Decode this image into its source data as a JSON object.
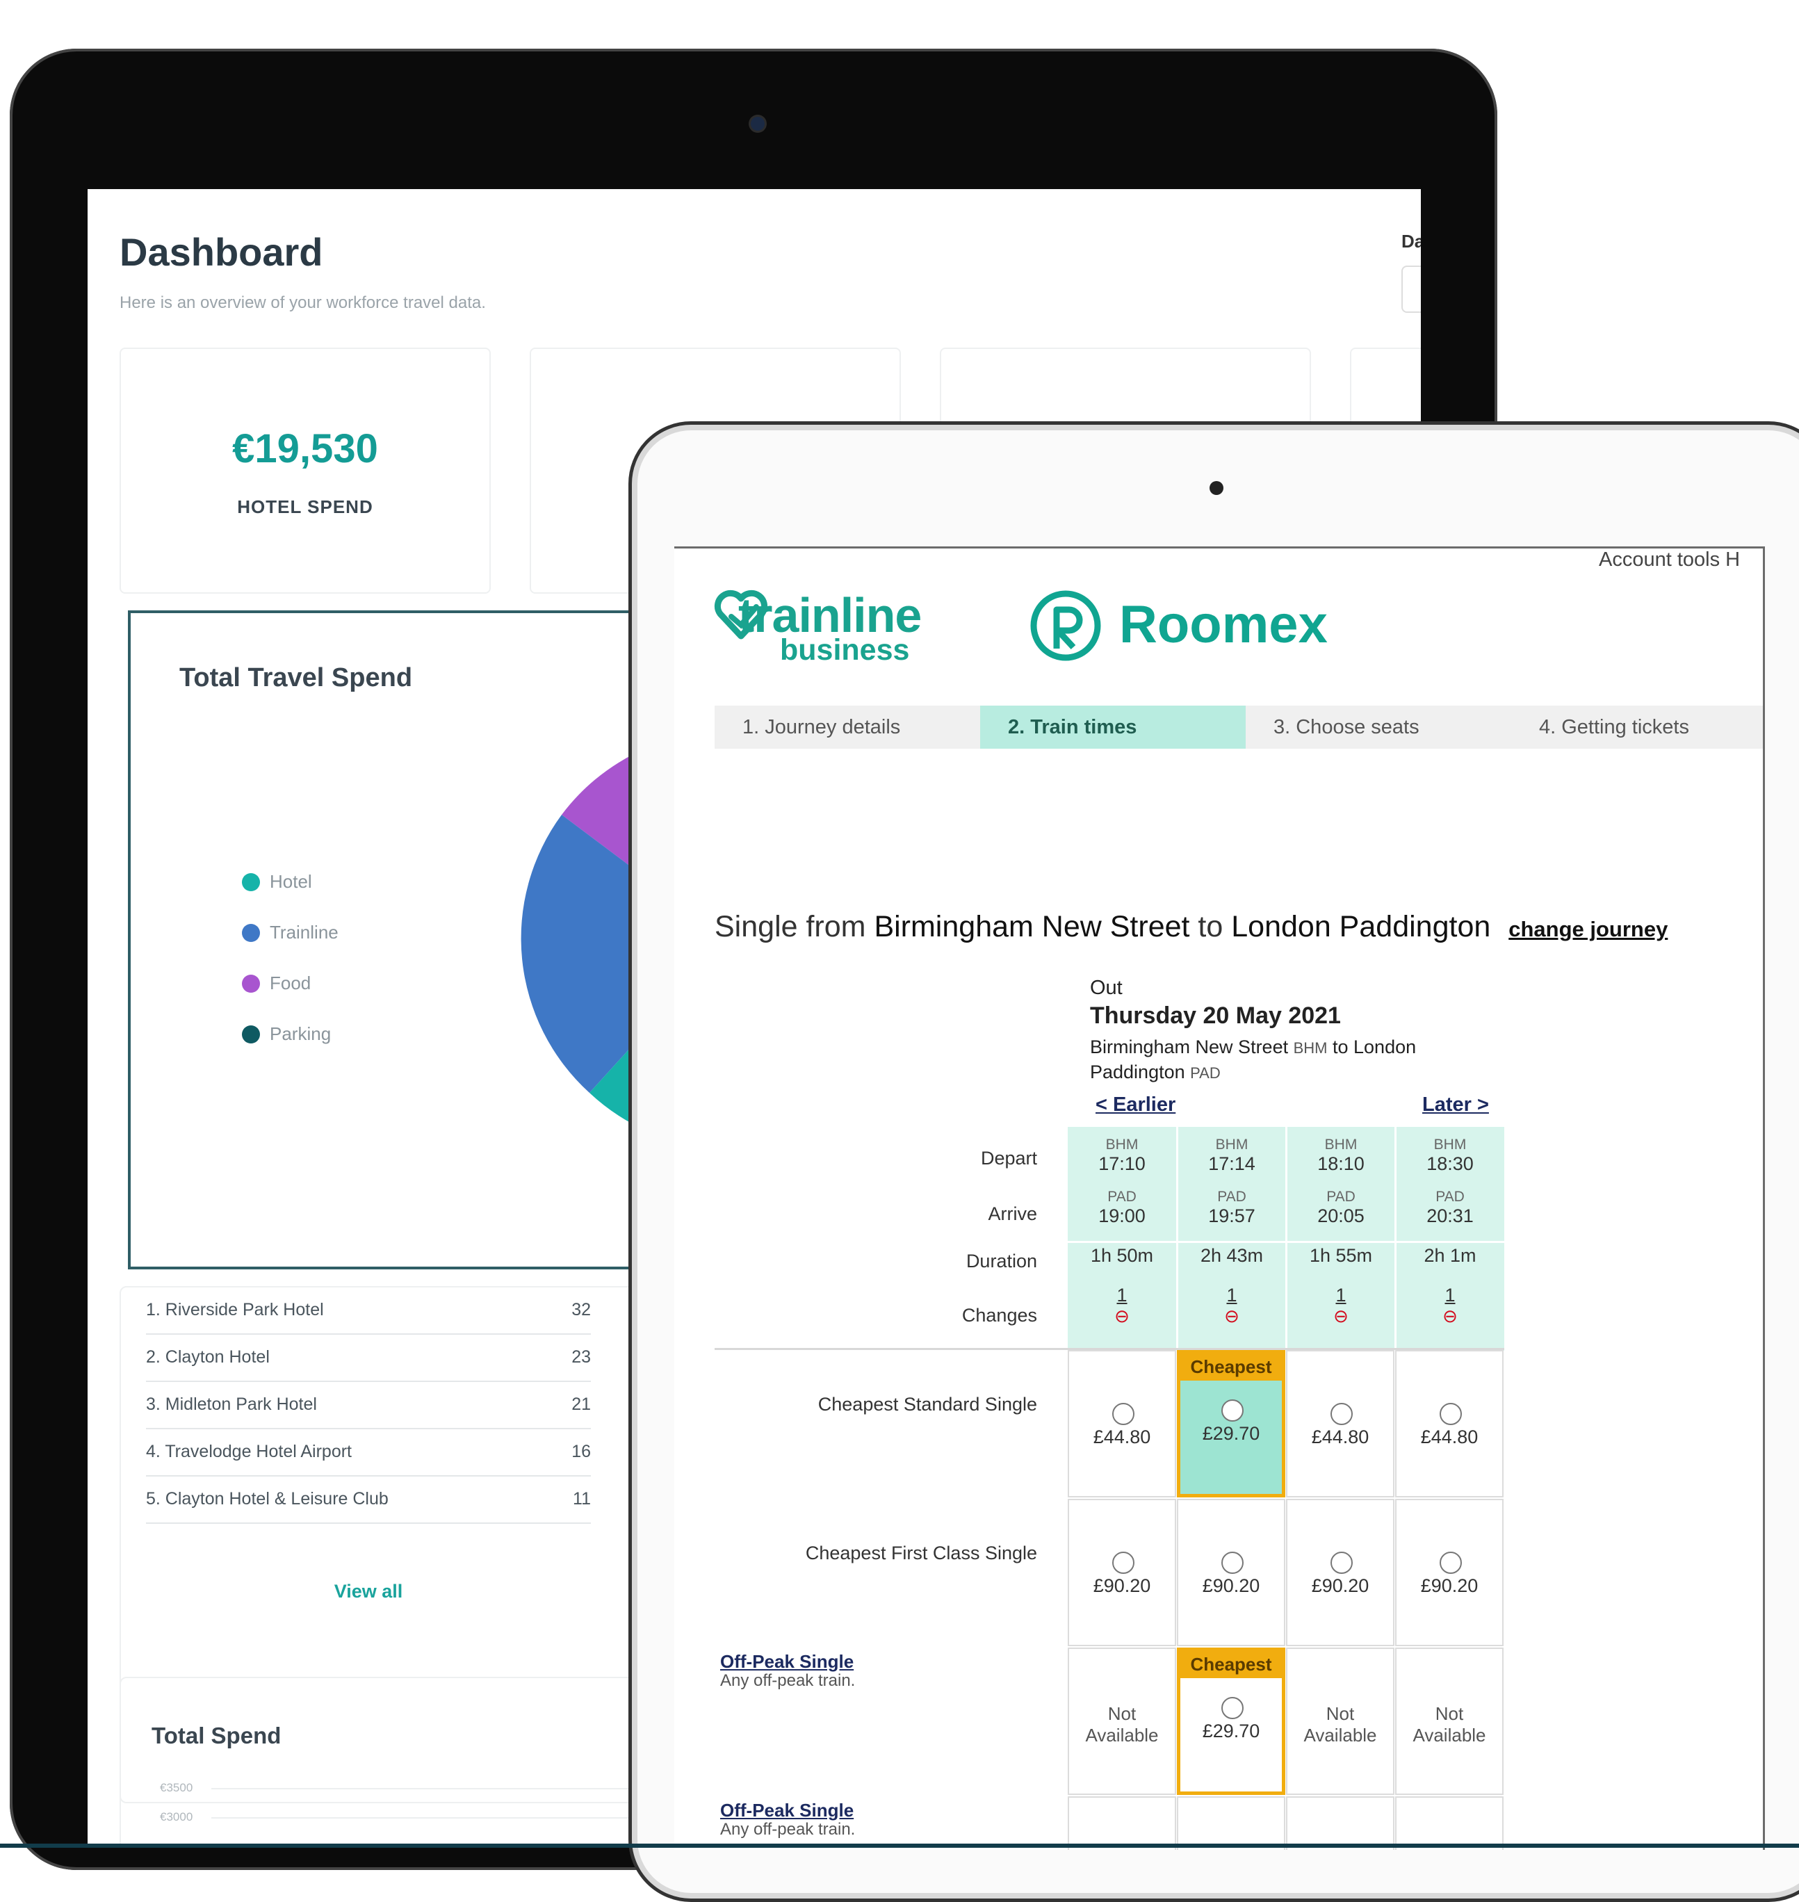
{
  "dashboard": {
    "title": "Dashboard",
    "subtitle": "Here is an overview of your workforce travel data.",
    "cut_off_label": "Da",
    "kpi": {
      "value": "€19,530",
      "label": "HOTEL SPEND"
    },
    "total_travel_spend": {
      "title": "Total Travel Spend",
      "legend": [
        {
          "label": "Hotel",
          "color": "#16b3a9"
        },
        {
          "label": "Trainline",
          "color": "#3f78c6"
        },
        {
          "label": "Food",
          "color": "#a855cf"
        },
        {
          "label": "Parking",
          "color": "#0f5a62"
        }
      ]
    },
    "top_hotels": [
      {
        "name": "1.  Riverside Park Hotel",
        "count": "32"
      },
      {
        "name": "2.  Clayton Hotel",
        "count": "23"
      },
      {
        "name": "3.  Midleton Park Hotel",
        "count": "21"
      },
      {
        "name": "4.  Travelodge Hotel Airport",
        "count": "16"
      },
      {
        "name": "5.  Clayton Hotel & Leisure Club",
        "count": "11"
      }
    ],
    "view_all": "View all",
    "total_spend": {
      "title": "Total Spend",
      "y_ticks": [
        "€3500",
        "€3000"
      ]
    }
  },
  "booking": {
    "account_tools": "Account tools   H",
    "brand": {
      "trainline": "trainline",
      "business": "business",
      "roomex": "Roomex"
    },
    "steps": [
      {
        "label": "1. Journey details"
      },
      {
        "label": "2. Train times",
        "active": true
      },
      {
        "label": "3. Choose seats"
      },
      {
        "label": "4. Getting tickets"
      }
    ],
    "journey": {
      "prefix": "Single from ",
      "from": "Birmingham New Street",
      "mid": " to ",
      "to": "London Paddington",
      "change_link": "change journey"
    },
    "out": {
      "label": "Out",
      "date": "Thursday 20 May 2021",
      "route_line1_a": "Birmingham New Street ",
      "route_line1_code": "BHM",
      "route_line1_b": " to London",
      "route_line2_a": "Paddington ",
      "route_line2_code": "PAD"
    },
    "earlier": "< Earlier",
    "later": "Later >",
    "row_labels": {
      "depart": "Depart",
      "arrive": "Arrive",
      "duration": "Duration",
      "changes": "Changes"
    },
    "trains": [
      {
        "dep_code": "BHM",
        "dep": "17:10",
        "arr_code": "PAD",
        "arr": "19:00",
        "duration": "1h 50m",
        "changes": "1",
        "tube": "⊖"
      },
      {
        "dep_code": "BHM",
        "dep": "17:14",
        "arr_code": "PAD",
        "arr": "19:57",
        "duration": "2h 43m",
        "changes": "1",
        "tube": "⊖"
      },
      {
        "dep_code": "BHM",
        "dep": "18:10",
        "arr_code": "PAD",
        "arr": "20:05",
        "duration": "1h 55m",
        "changes": "1",
        "tube": "⊖"
      },
      {
        "dep_code": "BHM",
        "dep": "18:30",
        "arr_code": "PAD",
        "arr": "20:31",
        "duration": "2h 1m",
        "changes": "1",
        "tube": "⊖"
      }
    ],
    "fares": {
      "standard": {
        "label": "Cheapest Standard Single",
        "prices": [
          "£44.80",
          "£29.70",
          "£44.80",
          "£44.80"
        ]
      },
      "first": {
        "label": "Cheapest First Class Single",
        "prices": [
          "£90.20",
          "£90.20",
          "£90.20",
          "£90.20"
        ]
      },
      "offpeak": {
        "link": "Off-Peak Single",
        "desc": "Any off-peak train.",
        "na_line1": "Not",
        "na_line2": "Available",
        "price": "£29.70"
      },
      "offpeak2": {
        "link": "Off-Peak Single",
        "desc": "Any off-peak train."
      }
    },
    "cheapest_tag": "Cheapest"
  }
}
